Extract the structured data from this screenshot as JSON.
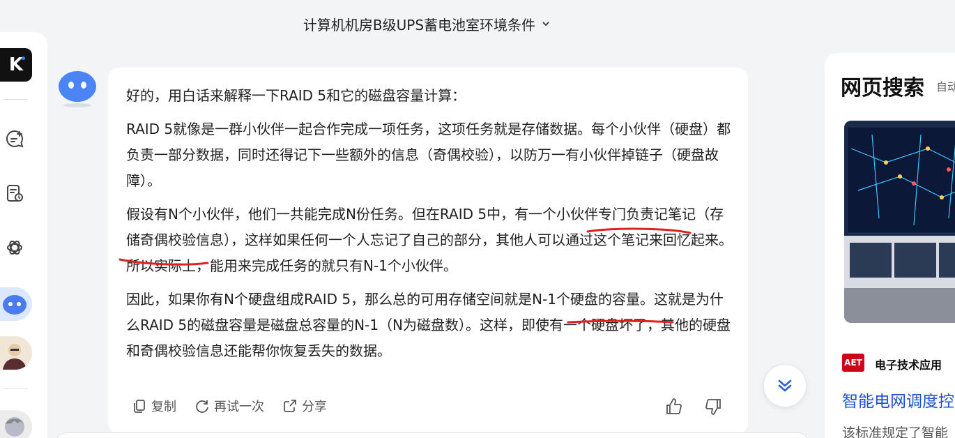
{
  "header": {
    "title": "计算机机房B级UPS蓄电池室环境条件"
  },
  "rail": {
    "logo_text": "K"
  },
  "message": {
    "paragraphs": [
      "好的，用白话来解释一下RAID 5和它的磁盘容量计算：",
      "RAID 5就像是一群小伙伴一起合作完成一项任务，这项任务就是存储数据。每个小伙伴（硬盘）都负责一部分数据，同时还得记下一些额外的信息（奇偶校验），以防万一有小伙伴掉链子（硬盘故障）。"
    ],
    "p3": {
      "a": "假设有N个小伙伴，他们一共能完成N份任务。但在RAID 5中，有一",
      "b": "个小伙伴专门负",
      "c": "责记",
      "d": "笔记（存储奇偶",
      "e": "校验信息），这样如果任何一个人忘记了自己的部分，其他人可以通过这个笔记来回忆起来。所以实际上，能用来完成任务的就只有N-1个小伙伴。"
    },
    "p4": {
      "a": "因此，如果你有N个硬盘组成RAID 5，那么总的可用存储空间就是",
      "b": "N-1个硬盘的容量",
      "c": "。这就是为什么RAID 5的磁盘容量是磁盘总容量的N-1（N为磁盘数）。这样，即使有一个硬盘坏了，其他的硬盘和奇偶校验信息还能帮你恢复丢失的数据。"
    }
  },
  "actions": {
    "copy": "复制",
    "retry": "再试一次",
    "share": "分享"
  },
  "side": {
    "title": "网页搜索",
    "subtitle": "自动",
    "source_logo": "AET",
    "source_name": "电子技术应用",
    "link": "智能电网调度控",
    "snippet": "该标准规定了智能"
  },
  "colors": {
    "underline": "#e02020",
    "link": "#1d4ed8",
    "accent": "#3b82f6"
  }
}
